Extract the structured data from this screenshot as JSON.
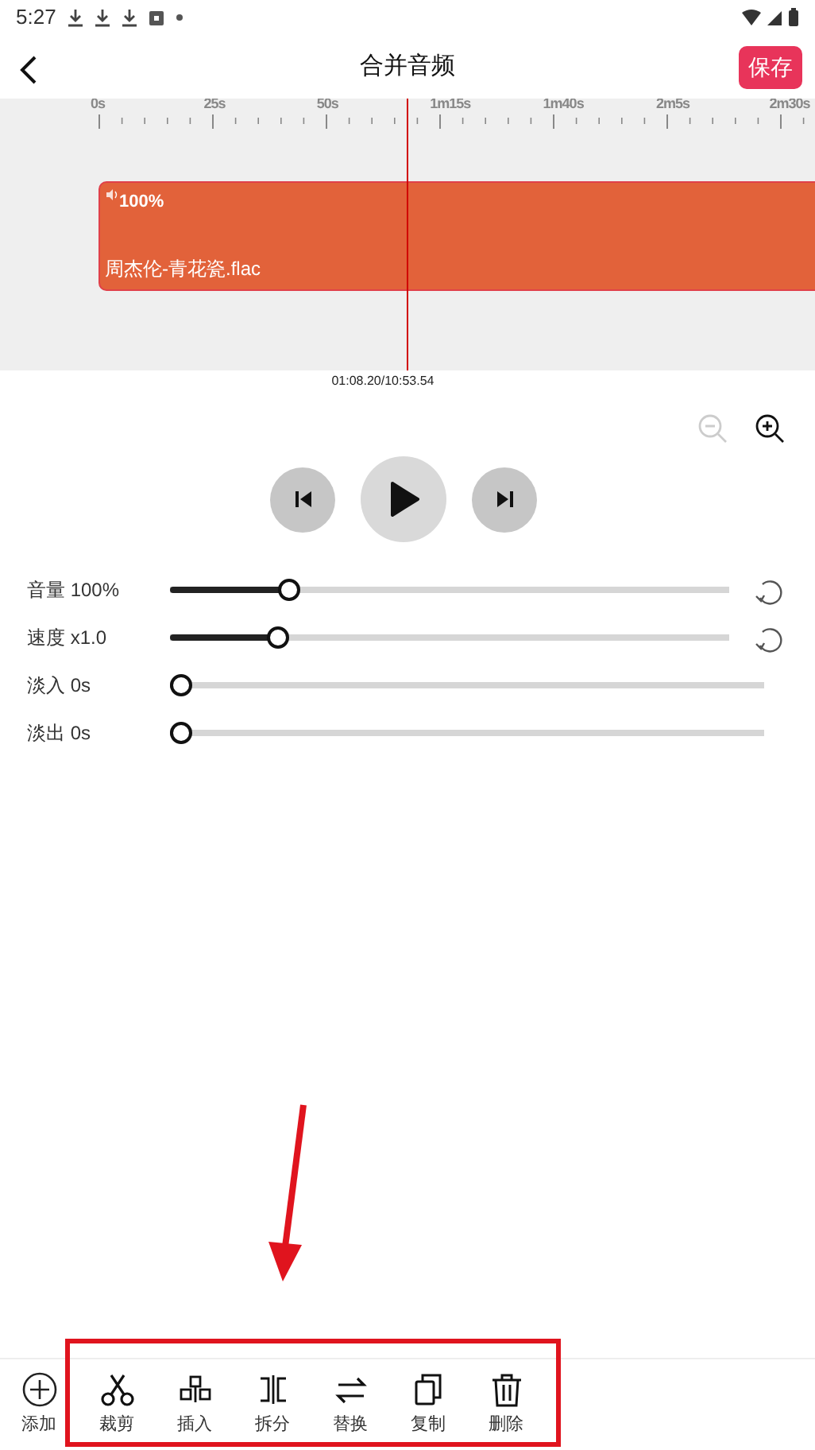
{
  "status_bar": {
    "time": "5:27"
  },
  "header": {
    "title": "合并音频",
    "save_label": "保存"
  },
  "timeline": {
    "ruler_labels": [
      "0s",
      "25s",
      "50s",
      "1m15s",
      "1m40s",
      "2m5s",
      "2m30s"
    ],
    "clip": {
      "volume": "100%",
      "name": "周杰伦-青花瓷.flac"
    },
    "position": "01:08.20/10:53.54"
  },
  "zoom": [
    {
      "kind": "out",
      "disabled": true
    },
    {
      "kind": "in",
      "disabled": false
    }
  ],
  "sliders": [
    {
      "label": "音量 100%",
      "level": 0.2,
      "kind": "resettable"
    },
    {
      "label": "速度 x1.0",
      "level": 0.18,
      "kind": "resettable"
    },
    {
      "label": "淡入 0s",
      "level": 0,
      "kind": "plain"
    },
    {
      "label": "淡出 0s",
      "level": 0,
      "kind": "plain"
    }
  ],
  "toolbar": [
    {
      "kind": "add",
      "label": "添加"
    },
    {
      "kind": "cut",
      "label": "裁剪"
    },
    {
      "kind": "insert",
      "label": "插入"
    },
    {
      "kind": "split",
      "label": "拆分"
    },
    {
      "kind": "replace",
      "label": "替换"
    },
    {
      "kind": "copy",
      "label": "复制"
    },
    {
      "kind": "delete",
      "label": "删除"
    }
  ]
}
